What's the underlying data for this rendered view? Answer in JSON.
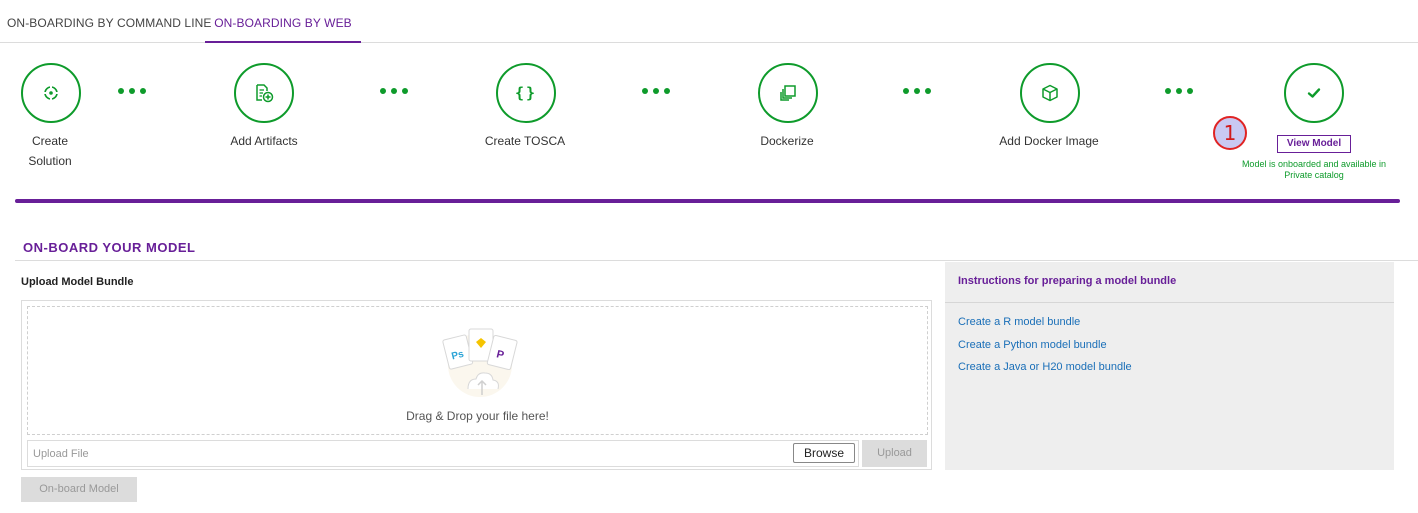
{
  "tabs": [
    {
      "label": "ON-BOARDING BY COMMAND LINE"
    },
    {
      "label": "ON-BOARDING BY WEB"
    }
  ],
  "steps": [
    {
      "label": "Create\nSolution",
      "icon": "target-icon"
    },
    {
      "label": "Add Artifacts",
      "icon": "document-add-icon"
    },
    {
      "label": "Create TOSCA",
      "icon": "braces-icon"
    },
    {
      "label": "Dockerize",
      "icon": "layers-icon"
    },
    {
      "label": "Add Docker Image",
      "icon": "cube-icon"
    },
    {
      "label": "",
      "icon": "check-icon"
    }
  ],
  "annotation_number": "1",
  "view_model_label": "View Model",
  "onboard_message": "Model is onboarded and available in Private catalog",
  "colors": {
    "primary": "#681f98",
    "success": "#0e9b2b",
    "link": "#1a6fb8"
  },
  "section": {
    "title": "ON-BOARD YOUR MODEL",
    "upload_title": "Upload Model Bundle",
    "drop_text": "Drag & Drop your file here!",
    "file_placeholder": "Upload File",
    "browse_label": "Browse",
    "upload_label": "Upload",
    "onboard_label": "On-board Model"
  },
  "instructions": {
    "title": "Instructions for preparing a model bundle",
    "links": [
      "Create a R model bundle",
      "Create a Python model bundle",
      "Create a Java or H20 model bundle"
    ]
  }
}
